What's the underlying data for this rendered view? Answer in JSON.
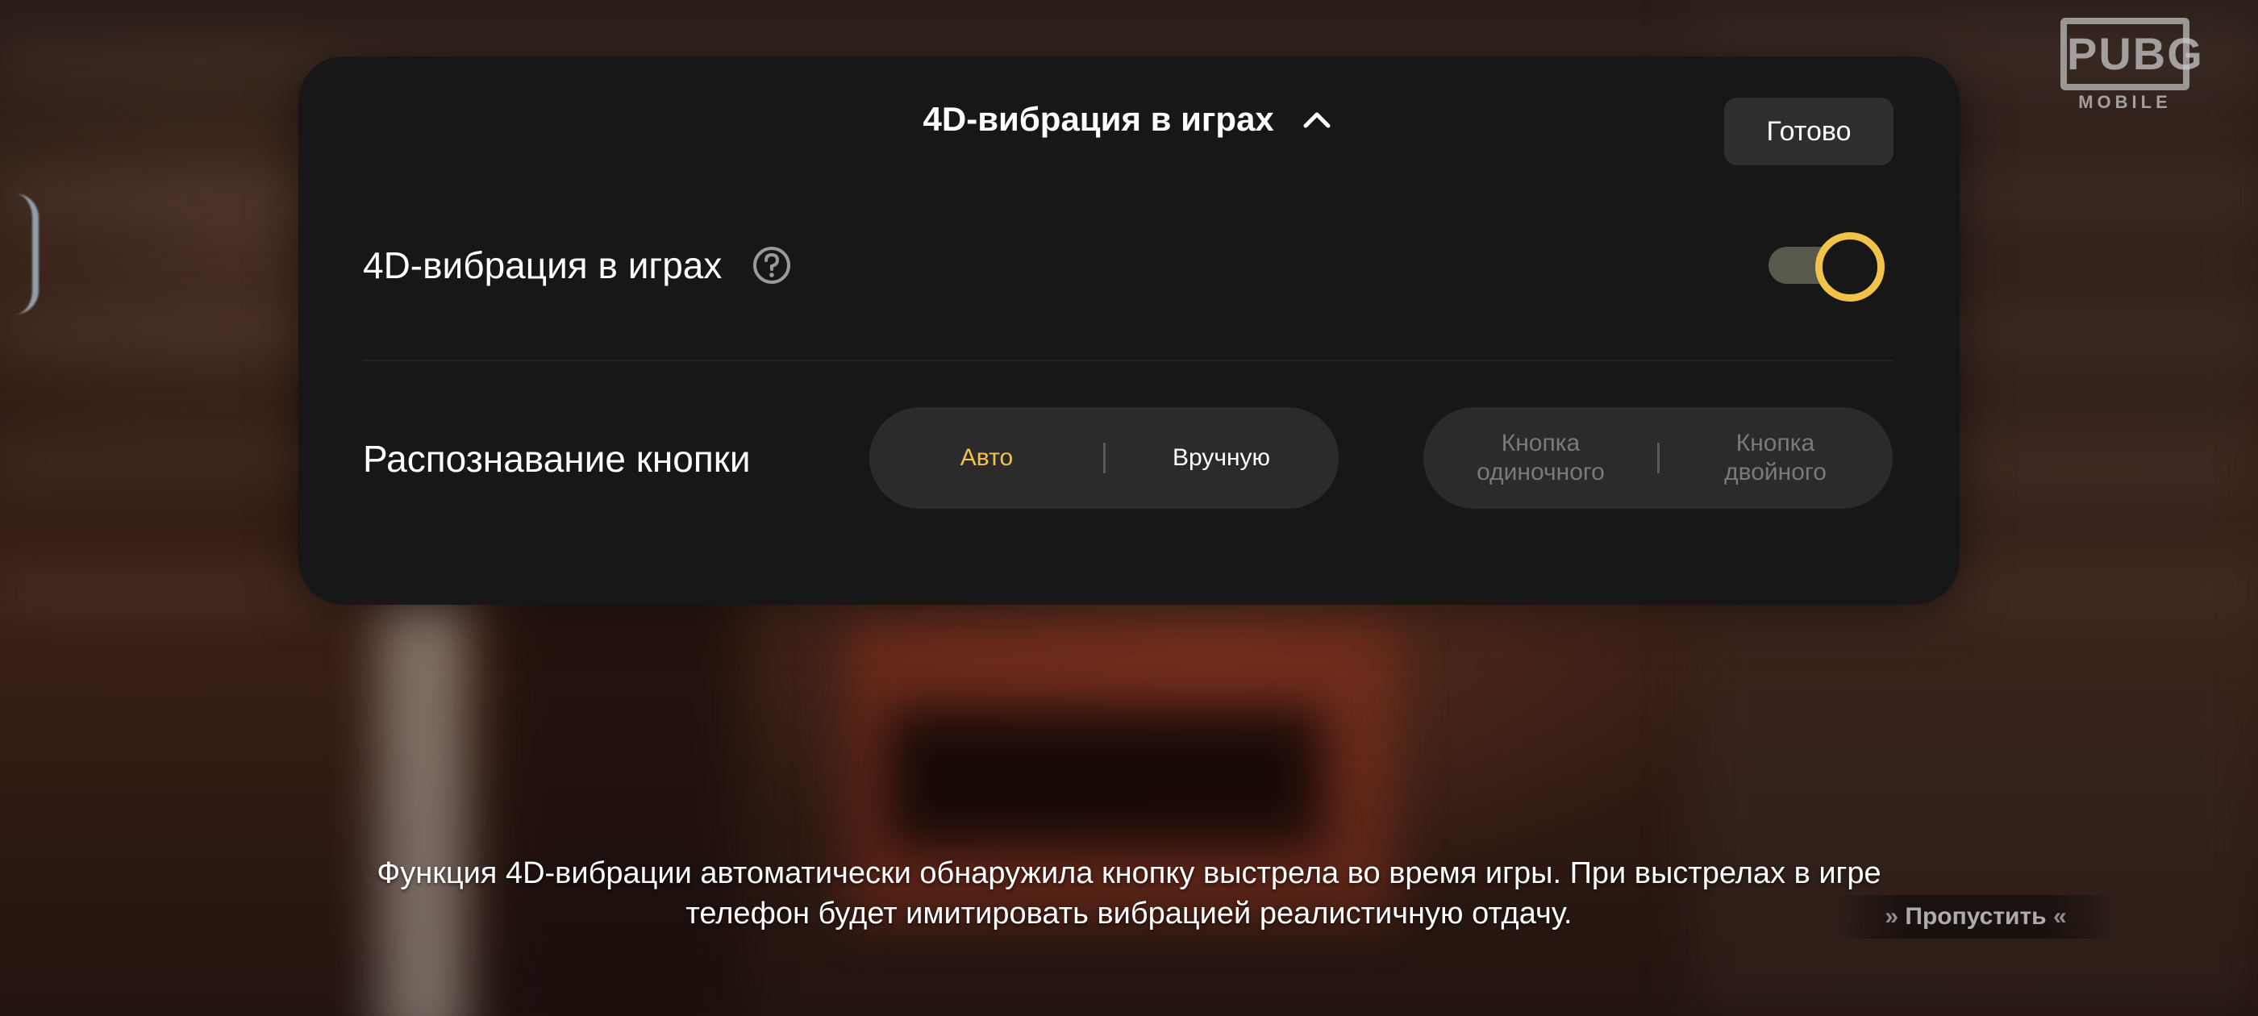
{
  "logo": {
    "main": "PUBG",
    "sub": "MOBILE"
  },
  "panel": {
    "title": "4D-вибрация в играх",
    "done_label": "Готово",
    "vibration_row": {
      "label": "4D-вибрация в играх",
      "toggle_on": true
    },
    "recognition_row": {
      "label": "Распознавание кнопки",
      "mode_options": [
        "Авто",
        "Вручную"
      ],
      "mode_selected": "Авто",
      "button_options": [
        "Кнопка одиночного",
        "Кнопка двойного"
      ]
    }
  },
  "caption": {
    "line1": "Функция 4D-вибрации автоматически обнаружила кнопку выстрела во время игры. При выстрелах в игре",
    "line2": "телефон будет имитировать вибрацией реалистичную отдачу."
  },
  "skip": {
    "label": "Пропустить",
    "left_arrows": "»",
    "right_arrows": "«"
  },
  "colors": {
    "accent": "#f2c24a",
    "panel_bg": "#171717",
    "control_bg": "#2b2b2b"
  }
}
